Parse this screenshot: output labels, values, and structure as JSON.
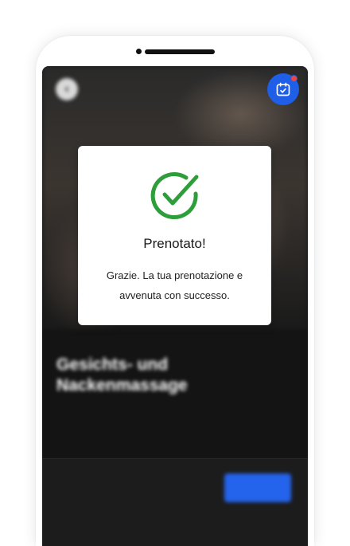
{
  "header": {
    "back_icon": "back-arrow-icon",
    "info_text": "",
    "calendar_icon": "calendar-check-icon",
    "notification_color": "#ef4444",
    "accent_color": "#1f5ee6"
  },
  "service": {
    "category": "",
    "title": "Gesichts- und Nackenmassage",
    "description": ""
  },
  "footer": {
    "price_label": "",
    "price_value": "",
    "book_label": ""
  },
  "modal": {
    "icon": "success-check-icon",
    "icon_color": "#2e9e3a",
    "title": "Prenotato!",
    "message": "Grazie. La tua prenotazione e avvenuta con successo."
  }
}
